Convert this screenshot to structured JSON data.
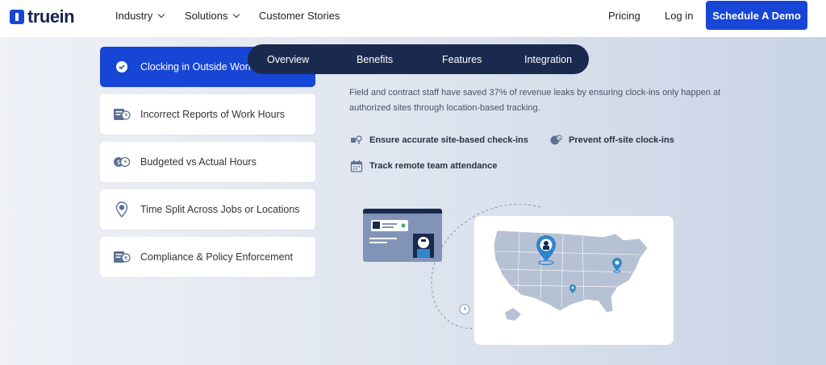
{
  "brand": {
    "name": "truein"
  },
  "nav": {
    "items": [
      {
        "label": "Industry",
        "has_dropdown": true
      },
      {
        "label": "Solutions",
        "has_dropdown": true
      },
      {
        "label": "Customer Stories",
        "has_dropdown": false
      }
    ],
    "pricing": "Pricing",
    "login": "Log in",
    "cta": "Schedule A Demo"
  },
  "use_cases": [
    {
      "label": "Clocking in Outside Work",
      "icon": "check-circle-icon",
      "active": true
    },
    {
      "label": "Incorrect Reports of Work Hours",
      "icon": "report-clock-icon",
      "active": false
    },
    {
      "label": "Budgeted vs Actual Hours",
      "icon": "budget-clock-icon",
      "active": false
    },
    {
      "label": "Time Split Across Jobs or Locations",
      "icon": "location-pin-icon",
      "active": false
    },
    {
      "label": "Compliance & Policy Enforcement",
      "icon": "policy-doc-icon",
      "active": false
    }
  ],
  "tabs": [
    {
      "label": "Overview"
    },
    {
      "label": "Benefits"
    },
    {
      "label": "Features"
    },
    {
      "label": "Integration"
    }
  ],
  "content": {
    "description": "Field and contract staff have saved 37% of revenue leaks by ensuring clock-ins only happen at authorized sites through location-based tracking.",
    "features": [
      {
        "label": "Ensure accurate site-based check-ins",
        "icon": "site-checkin-icon"
      },
      {
        "label": "Prevent off-site clock-ins",
        "icon": "offsite-block-icon"
      },
      {
        "label": "Track remote team attendance",
        "icon": "calendar-icon"
      }
    ]
  },
  "colors": {
    "brand_blue": "#1746d6",
    "navy": "#1a2a4f",
    "pin_blue": "#2f86c8"
  }
}
